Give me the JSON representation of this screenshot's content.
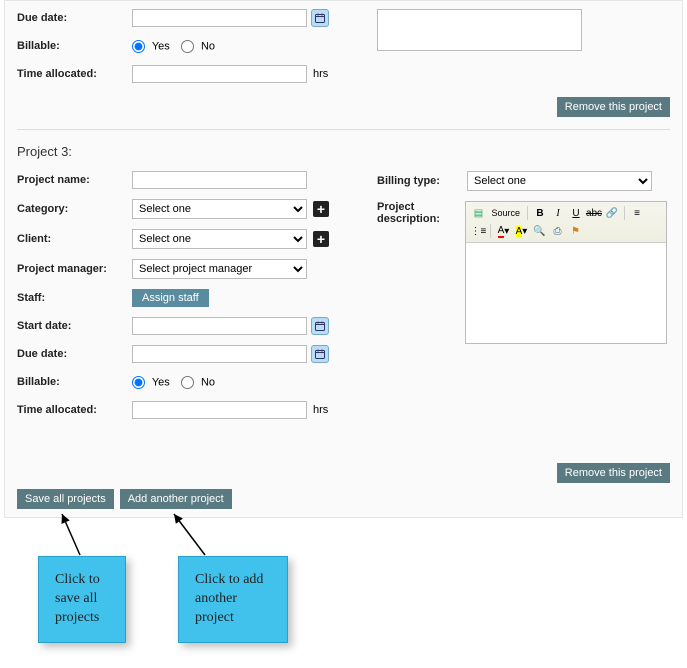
{
  "top": {
    "dueDateLabel": "Due date:",
    "billableLabel": "Billable:",
    "yes": "Yes",
    "no": "No",
    "timeAllocLabel": "Time allocated:",
    "hrs": "hrs",
    "removeBtn": "Remove this project"
  },
  "p3": {
    "title": "Project 3:",
    "projectNameLabel": "Project name:",
    "categoryLabel": "Category:",
    "categoryPlaceholder": "Select one",
    "clientLabel": "Client:",
    "clientPlaceholder": "Select one",
    "pmLabel": "Project manager:",
    "pmPlaceholder": "Select project manager",
    "staffLabel": "Staff:",
    "assignBtn": "Assign staff",
    "startDateLabel": "Start date:",
    "dueDateLabel": "Due date:",
    "billableLabel": "Billable:",
    "yes": "Yes",
    "no": "No",
    "timeAllocLabel": "Time allocated:",
    "hrs": "hrs",
    "billingTypeLabel": "Billing type:",
    "billingTypePlaceholder": "Select one",
    "descLabel": "Project description:",
    "rte": {
      "source": "Source",
      "bold": "B",
      "italic": "I",
      "underline": "U"
    },
    "removeBtn": "Remove this project"
  },
  "footer": {
    "saveAll": "Save all projects",
    "addAnother": "Add another project"
  },
  "callouts": {
    "save": "Click to save all projects",
    "add": "Click to add another project"
  }
}
